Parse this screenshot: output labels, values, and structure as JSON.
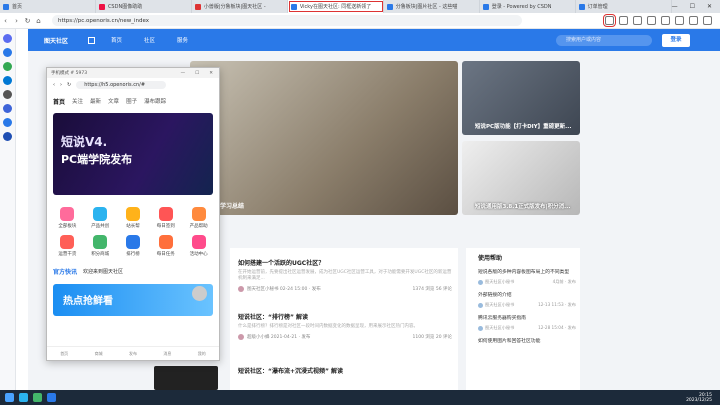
{
  "tabs": [
    {
      "label": "首页",
      "color": "#2a79e8"
    },
    {
      "label": "CSDN图像助助",
      "color": "#e14"
    },
    {
      "label": "小兽版|分鲁板块|图天社区 -",
      "color": "#d33"
    },
    {
      "label": "Vicky在图天社区: 同框送新领了",
      "color": "#2a79e8"
    },
    {
      "label": "分鲁板块|图片社区 - 这些喵",
      "color": "#2a79e8"
    },
    {
      "label": "登录 - Powered by CSDN",
      "color": "#2a79e8"
    },
    {
      "label": "订单管理",
      "color": "#2a79e8"
    }
  ],
  "address": {
    "url": "https://pc.openoris.cn/new_index"
  },
  "site": {
    "logo": "图天社区",
    "menu": [
      "首页",
      "社区",
      "服务"
    ],
    "search_placeholder": "搜索用户或内容",
    "login": "登录"
  },
  "banner": {
    "caption": "学习总结"
  },
  "cards": [
    {
      "caption": "短说PC版功能【打卡DIY】重磅更新..."
    },
    {
      "caption": "短说通用版3.8.1正式版发布|积分消..."
    }
  ],
  "feed": [
    {
      "title": "如何搭建一个活跃的UGC社区？",
      "desc": "在开始运营前，先要提出社区运营发展，成为社区UGC社区运营工具，对于功能需要开发UGC社区的新运营机制来满足...",
      "author": "图天社区小秘书 02-24 15:00 · 发布",
      "stats": "1374 浏览   56 评论"
    },
    {
      "title": "短说社区：“排行榜” 解读",
      "desc": "什么是排行榜？排行榜是对社区一段时间内数据变化的数据呈现，用来展示社区热门内容。",
      "author": "图天社区小秘书 2021-04-01 · 发布",
      "stats": "1307 浏览   23 评论"
    },
    {
      "title": "短说社区：“瀑布流+沉浸式视频” 解读",
      "desc": "",
      "author": "",
      "stats": ""
    }
  ],
  "feed_meta2": {
    "author": "超级小小蜂 2021-04-21 · 发布",
    "stats": "1100 浏览   20 评论"
  },
  "help": {
    "title": "使用帮助",
    "items": [
      {
        "title": "短说各版的多种内容板图布局上的不同类型",
        "author": "图天社区小秘书",
        "time": "4月前 · 发布"
      },
      {
        "title": "外部链接的介绍",
        "author": "图天社区小秘书",
        "time": "12-13 11:53 · 发布"
      },
      {
        "title": "腾讯云服务器购买指南",
        "author": "图天社区小秘书",
        "time": "12-28 15:04 · 发布"
      },
      {
        "title": "如何使用图片和回答社区功能",
        "author": "",
        "time": ""
      }
    ]
  },
  "phone": {
    "title": "手机模式 # 5973",
    "url": "https://h5.openoris.cn/#",
    "tabs": [
      "首页",
      "关注",
      "最新",
      "文章",
      "圈子",
      "瀑布跟踪"
    ],
    "banner_line1": "短说V4.",
    "banner_line2": "PC端学院发布",
    "icons": [
      {
        "label": "全部板块",
        "color": "#ff6b9b"
      },
      {
        "label": "产品共创",
        "color": "#2bb3ef"
      },
      {
        "label": "站长帮",
        "color": "#ffb21a"
      },
      {
        "label": "每日签到",
        "color": "#ff5555"
      },
      {
        "label": "产品帮助",
        "color": "#ff8a3d"
      },
      {
        "label": "运营干货",
        "color": "#ff5f57"
      },
      {
        "label": "积分商城",
        "color": "#43b66b"
      },
      {
        "label": "排行榜",
        "color": "#2a79e8"
      },
      {
        "label": "每日任务",
        "color": "#ff6f3b"
      },
      {
        "label": "活动中心",
        "color": "#ff4b8b"
      }
    ],
    "news_key": "官方快讯",
    "news_text": "欢迎来到图天社区",
    "hot": "热点抢鲜看",
    "bottom": [
      "首页",
      "商城",
      "发布",
      "消息",
      "我的"
    ]
  },
  "taskbar": {
    "time": "20:15",
    "date": "2023/12/25"
  }
}
